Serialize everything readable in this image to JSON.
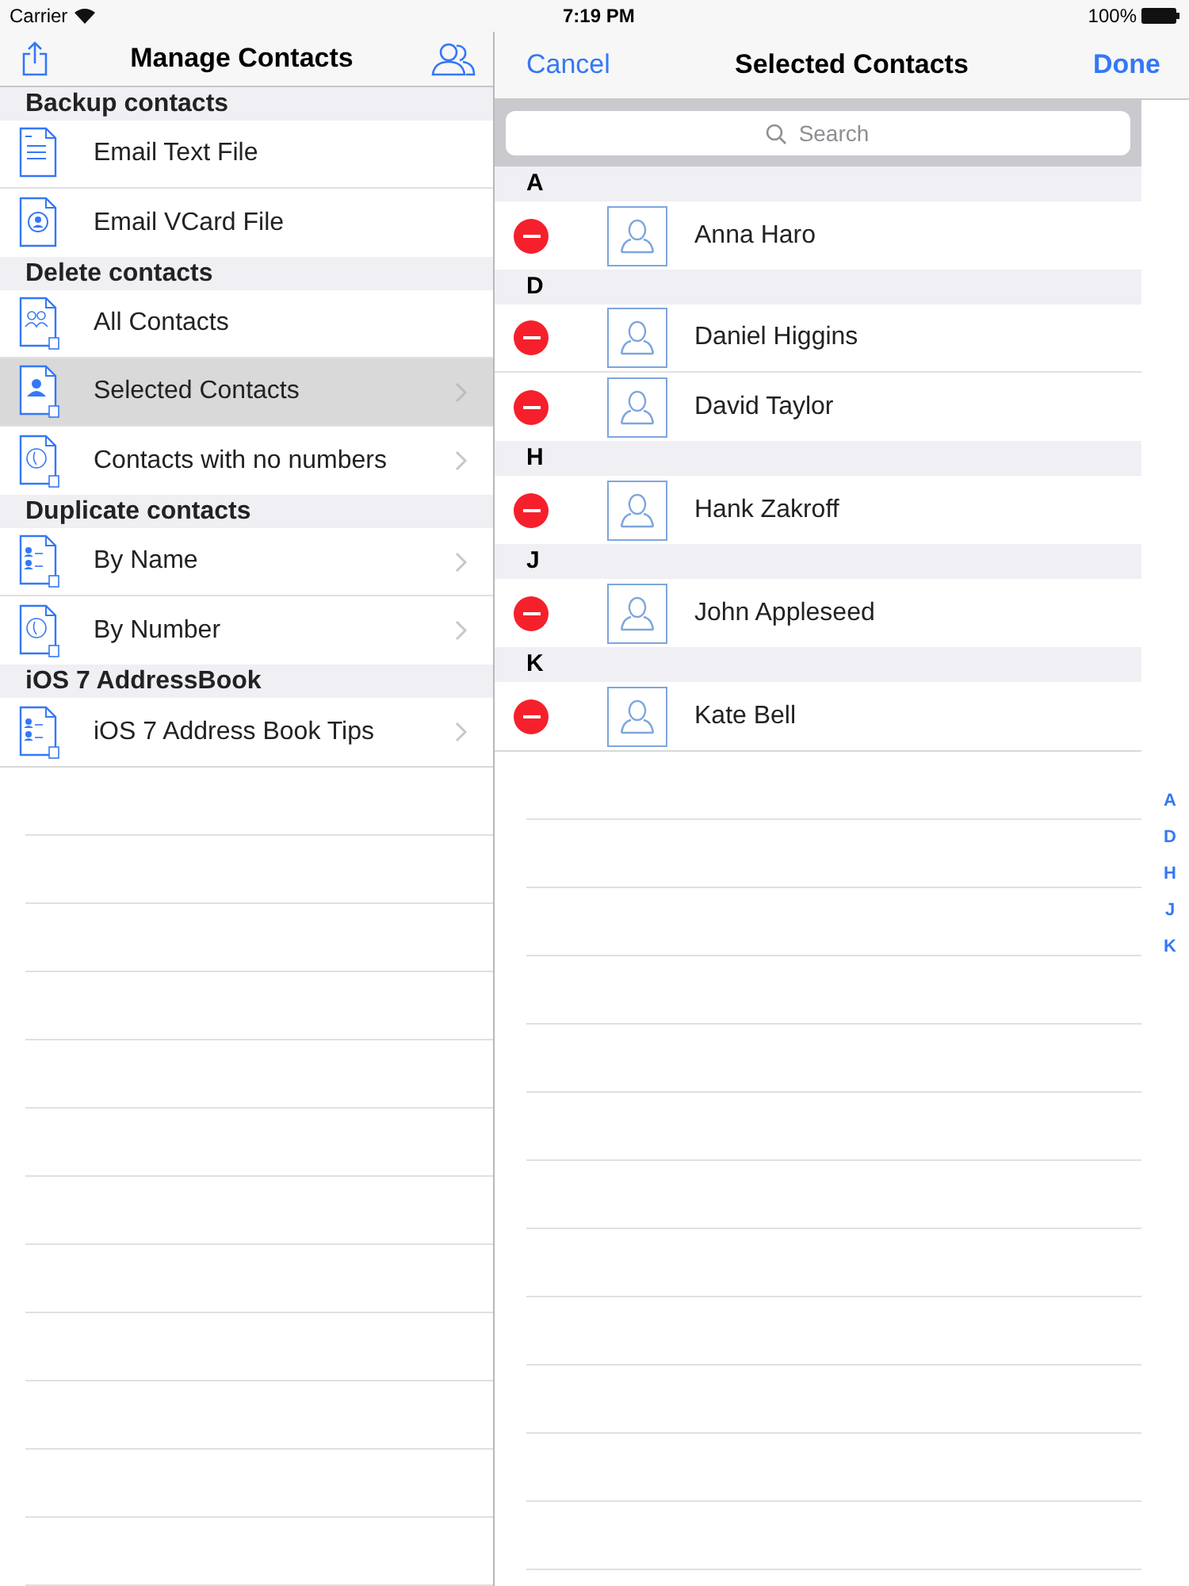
{
  "status_bar": {
    "carrier": "Carrier",
    "time": "7:19 PM",
    "battery": "100%"
  },
  "left_nav": {
    "title": "Manage Contacts"
  },
  "sections": [
    {
      "title": "Backup contacts",
      "items": [
        {
          "label": "Email Text File",
          "kind": "text",
          "chevron": false,
          "selected": false
        },
        {
          "label": "Email VCard File",
          "kind": "vcard",
          "chevron": false,
          "selected": false
        }
      ]
    },
    {
      "title": "Delete contacts",
      "items": [
        {
          "label": "All Contacts",
          "kind": "group",
          "chevron": false,
          "selected": false
        },
        {
          "label": "Selected Contacts",
          "kind": "person",
          "chevron": true,
          "selected": true
        },
        {
          "label": "Contacts with no numbers",
          "kind": "phone",
          "chevron": true,
          "selected": false
        }
      ]
    },
    {
      "title": "Duplicate contacts",
      "items": [
        {
          "label": "By Name",
          "kind": "duplicate",
          "chevron": true,
          "selected": false
        },
        {
          "label": "By Number",
          "kind": "phone",
          "chevron": true,
          "selected": false
        }
      ]
    },
    {
      "title": "iOS 7 AddressBook",
      "items": [
        {
          "label": "iOS 7 Address Book Tips",
          "kind": "duplicate",
          "chevron": true,
          "selected": false
        }
      ]
    }
  ],
  "right_nav": {
    "cancel": "Cancel",
    "title": "Selected Contacts",
    "done": "Done"
  },
  "search": {
    "placeholder": "Search"
  },
  "contact_groups": [
    {
      "letter": "A",
      "contacts": [
        "Anna Haro"
      ]
    },
    {
      "letter": "D",
      "contacts": [
        "Daniel Higgins",
        "David Taylor"
      ]
    },
    {
      "letter": "H",
      "contacts": [
        "Hank Zakroff"
      ]
    },
    {
      "letter": "J",
      "contacts": [
        "John Appleseed"
      ]
    },
    {
      "letter": "K",
      "contacts": [
        "Kate Bell"
      ]
    }
  ],
  "index": [
    "A",
    "D",
    "H",
    "J",
    "K"
  ]
}
